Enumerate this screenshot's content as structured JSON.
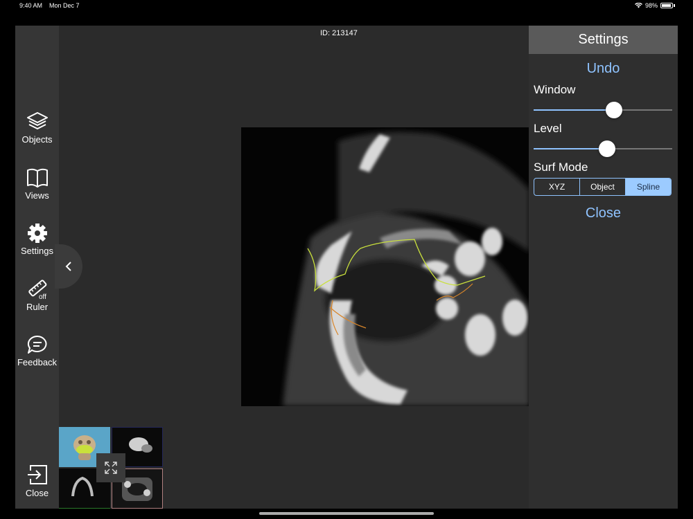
{
  "status_bar": {
    "time": "9:40 AM",
    "date": "Mon Dec 7",
    "battery": "98%"
  },
  "case": {
    "id_label": "ID: 213147"
  },
  "sidebar": {
    "items": [
      {
        "label": "Objects",
        "icon": "layers-icon"
      },
      {
        "label": "Views",
        "icon": "book-icon"
      },
      {
        "label": "Settings",
        "icon": "gear-icon"
      },
      {
        "label": "Ruler",
        "icon": "ruler-icon",
        "badge": "off"
      },
      {
        "label": "Feedback",
        "icon": "chat-bubble-icon"
      }
    ],
    "close_label": "Close"
  },
  "settings": {
    "title": "Settings",
    "undo": "Undo",
    "window": {
      "label": "Window",
      "value_fraction": 0.58
    },
    "level": {
      "label": "Level",
      "value_fraction": 0.53
    },
    "surf_mode": {
      "label": "Surf Mode",
      "options": [
        "XYZ",
        "Object",
        "Spline"
      ],
      "selected": "Spline"
    },
    "close": "Close"
  },
  "colors": {
    "accent": "#8fc3ff",
    "header": "#5a5a5a",
    "spline_green": "#c9e03c",
    "spline_orange": "#d9862a"
  }
}
